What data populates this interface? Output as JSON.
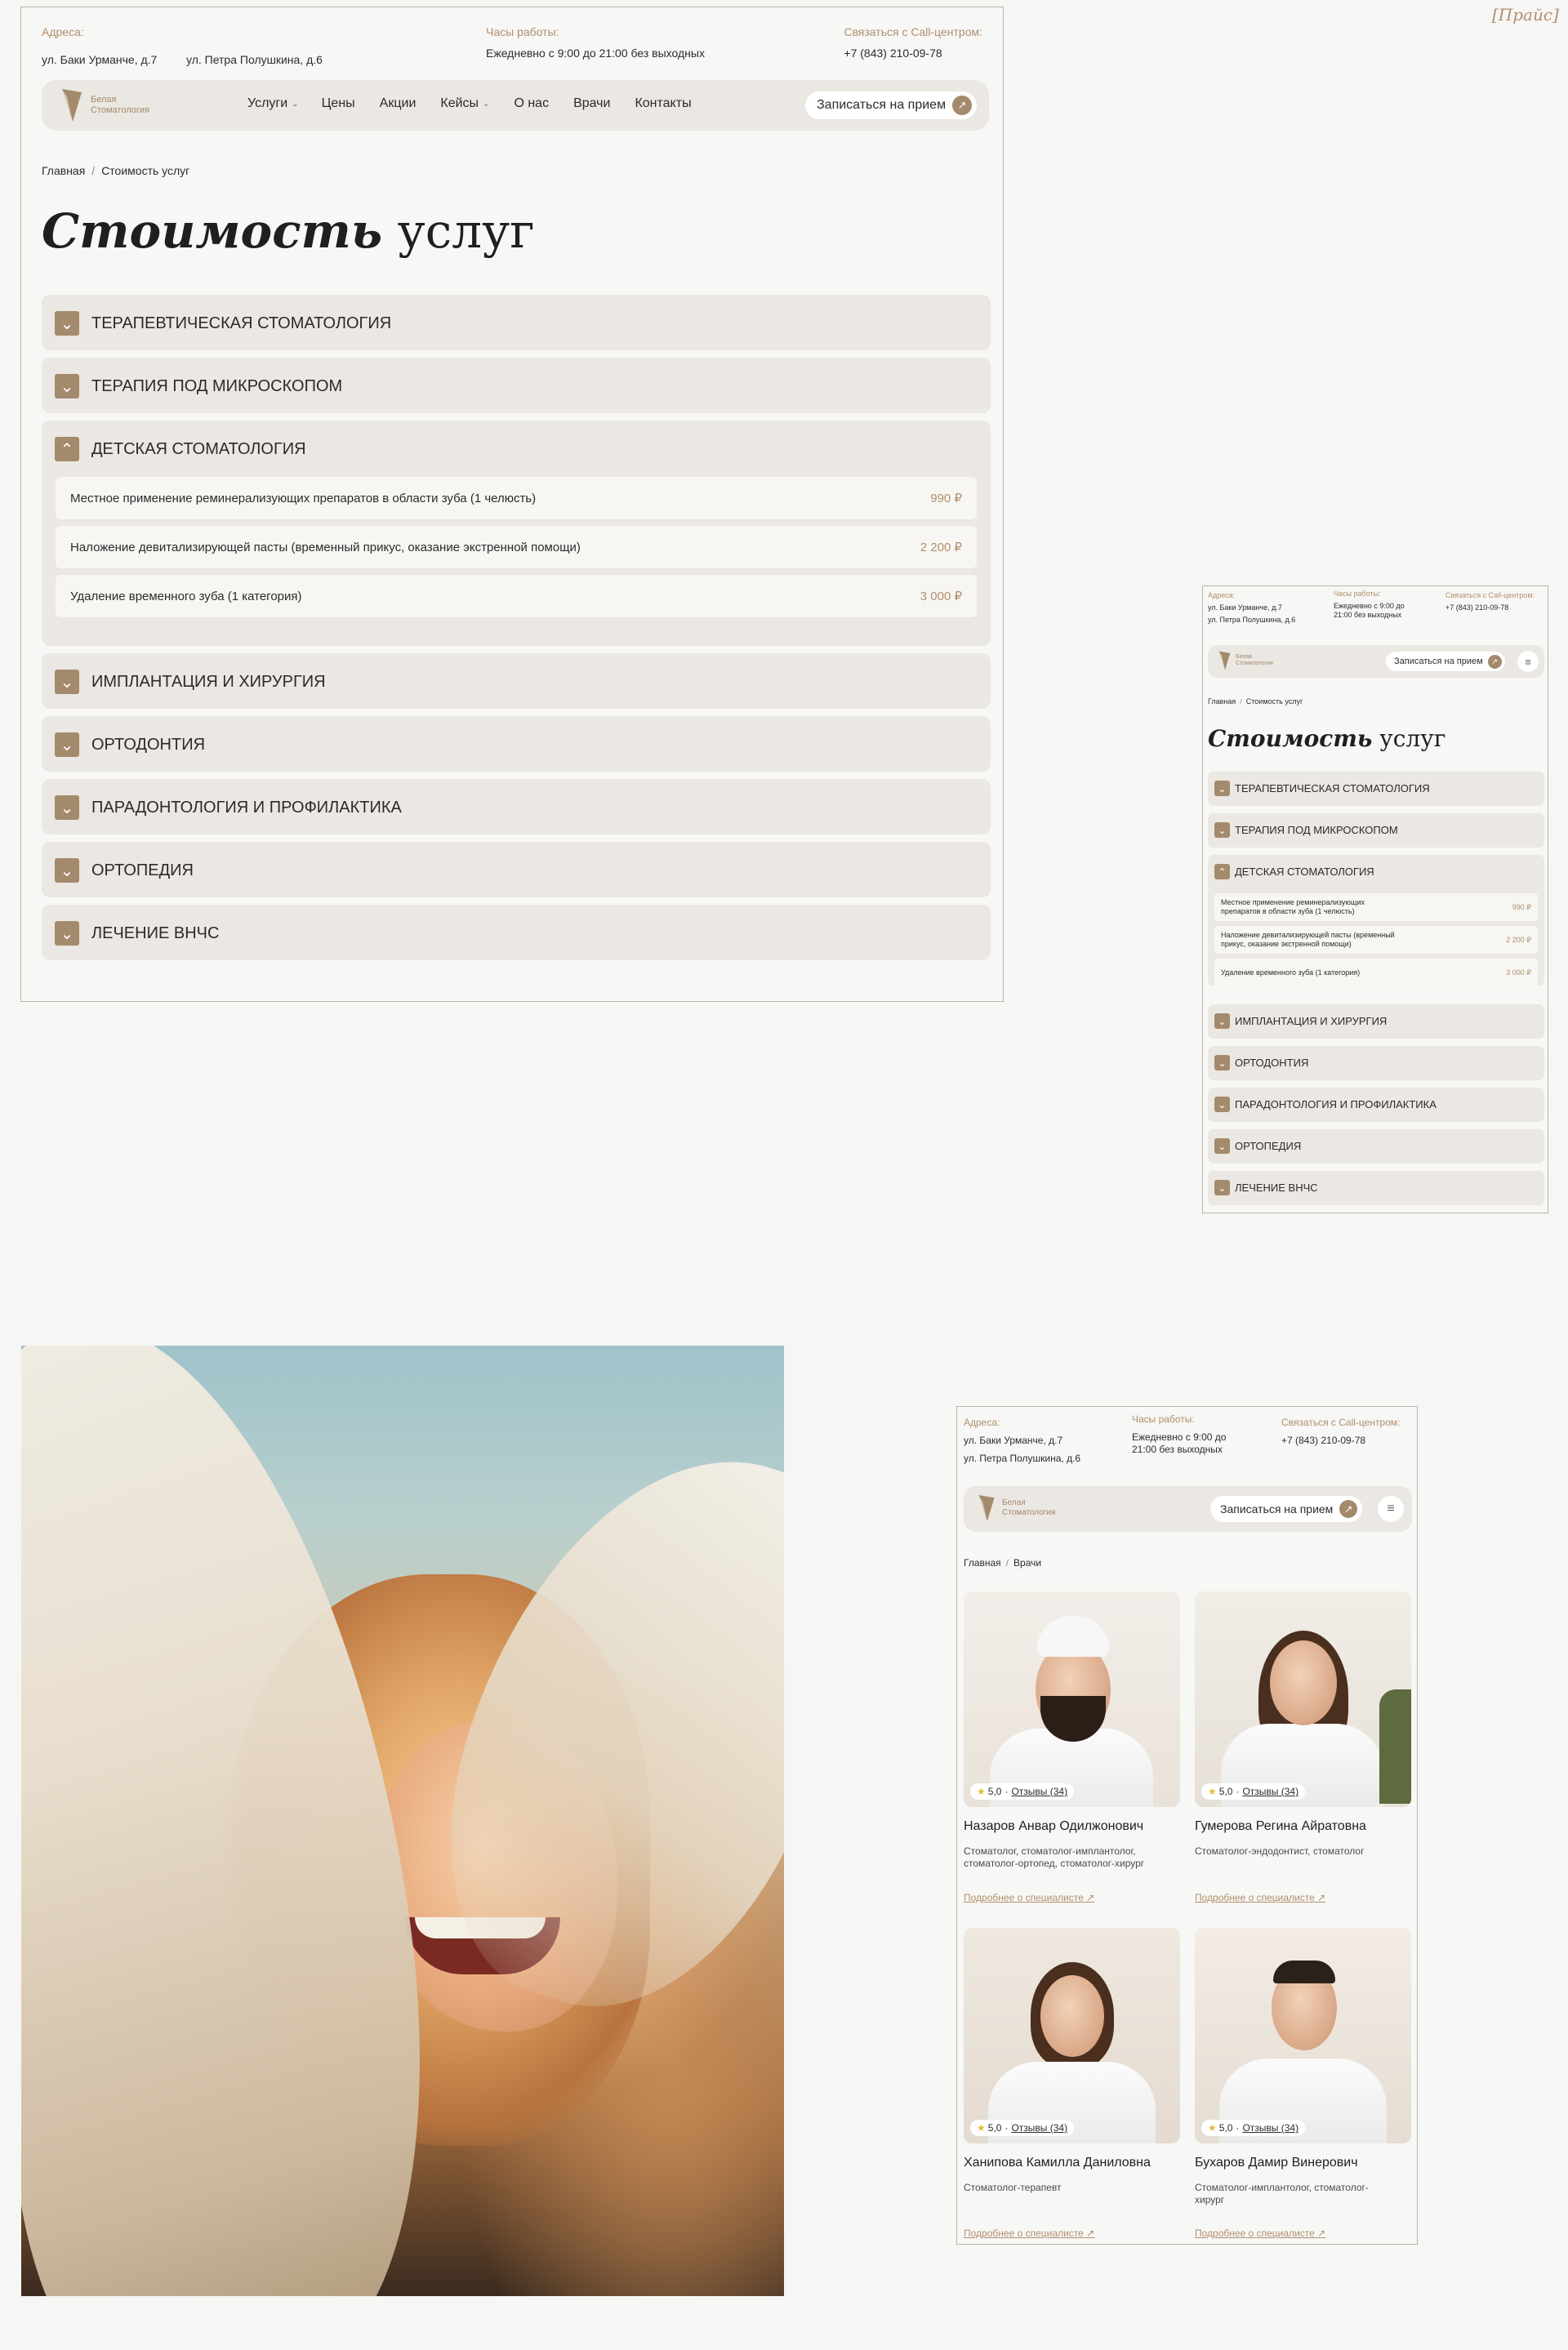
{
  "corner_tag": "[Прайс]",
  "header": {
    "addresses_label": "Адреса:",
    "address1": "ул. Баки Урманче, д.7",
    "address2": "ул. Петра Полушкина, д.6",
    "hours_label": "Часы работы:",
    "hours": "Ежедневно с 9:00 до 21:00 без выходных",
    "hours_short_1": "Ежедневно с 9:00 до",
    "hours_short_2": "21:00 без выходных",
    "call_label": "Связаться с Call-центром:",
    "phone": "+7 (843) 210-09-78"
  },
  "logo": {
    "line1": "Белая",
    "line2": "Стоматология"
  },
  "nav": {
    "items": [
      "Услуги",
      "Цены",
      "Акции",
      "Кейсы",
      "О нас",
      "Врачи",
      "Контакты"
    ],
    "cta": "Записаться на прием",
    "cta_arrow": "↗"
  },
  "breadcrumbs": {
    "home": "Главная",
    "sep": "/",
    "current": "Стоимость услуг",
    "current_doctors": "Врачи"
  },
  "title": {
    "italic": "Стоимость",
    "regular": "услуг"
  },
  "accordion": {
    "collapsed_icon": "⌄",
    "expanded_icon": "⌃",
    "sections": [
      "ТЕРАПЕВТИЧЕСКАЯ СТОМАТОЛОГИЯ",
      "ТЕРАПИЯ ПОД МИКРОСКОПОМ",
      "ДЕТСКАЯ СТОМАТОЛОГИЯ",
      "ИМПЛАНТАЦИЯ И ХИРУРГИЯ",
      "ОРТОДОНТИЯ",
      "ПАРАДОНТОЛОГИЯ И ПРОФИЛАКТИКА",
      "ОРТОПЕДИЯ",
      "ЛЕЧЕНИЕ  ВНЧС"
    ],
    "expanded_rows": [
      {
        "name": "Местное применение реминерализующих препаратов в области зуба (1 челюсть)",
        "name_m1": "Местное применение реминерализующих",
        "name_m2": "препаратов в области зуба (1 челюсть)",
        "price": "990 ₽"
      },
      {
        "name": "Наложение девитализирующей пасты (временный прикус, оказание экстренной помощи)",
        "name_m1": "Наложение девитализирующей пасты (временный",
        "name_m2": "прикус, оказание экстренной помощи)",
        "price": "2 200 ₽"
      },
      {
        "name": "Удаление временного зуба (1 категория)",
        "price": "3 000 ₽"
      }
    ]
  },
  "doctors": {
    "more": "Подробнее о специалисте",
    "more_arrow": "↗",
    "rating_star": "★",
    "items": [
      {
        "rating": "5,0",
        "reviews": "Отзывы (34)",
        "name": "Назаров Анвар Одилжонович",
        "role1": "Стоматолог, стоматолог-имплантолог,",
        "role2": "стоматолог-ортопед, стоматолог-хирург"
      },
      {
        "rating": "5,0",
        "reviews": "Отзывы (34)",
        "name": "Гумерова Регина Айратовна",
        "role1": "Стоматолог-эндодонтист, стоматолог",
        "role2": ""
      },
      {
        "rating": "5,0",
        "reviews": "Отзывы (34)",
        "name": "Ханипова Камилла Даниловна",
        "role1": "Стоматолог-терапевт",
        "role2": ""
      },
      {
        "rating": "5,0",
        "reviews": "Отзывы (34)",
        "name": "Бухаров Дамир Винерович",
        "role1": "Стоматолог-имплантолог, стоматолог-",
        "role2": "хирург"
      }
    ]
  },
  "colors": {
    "accent": "#a48a6c",
    "panel": "#ebe7e2",
    "background": "#f6f6f4"
  }
}
